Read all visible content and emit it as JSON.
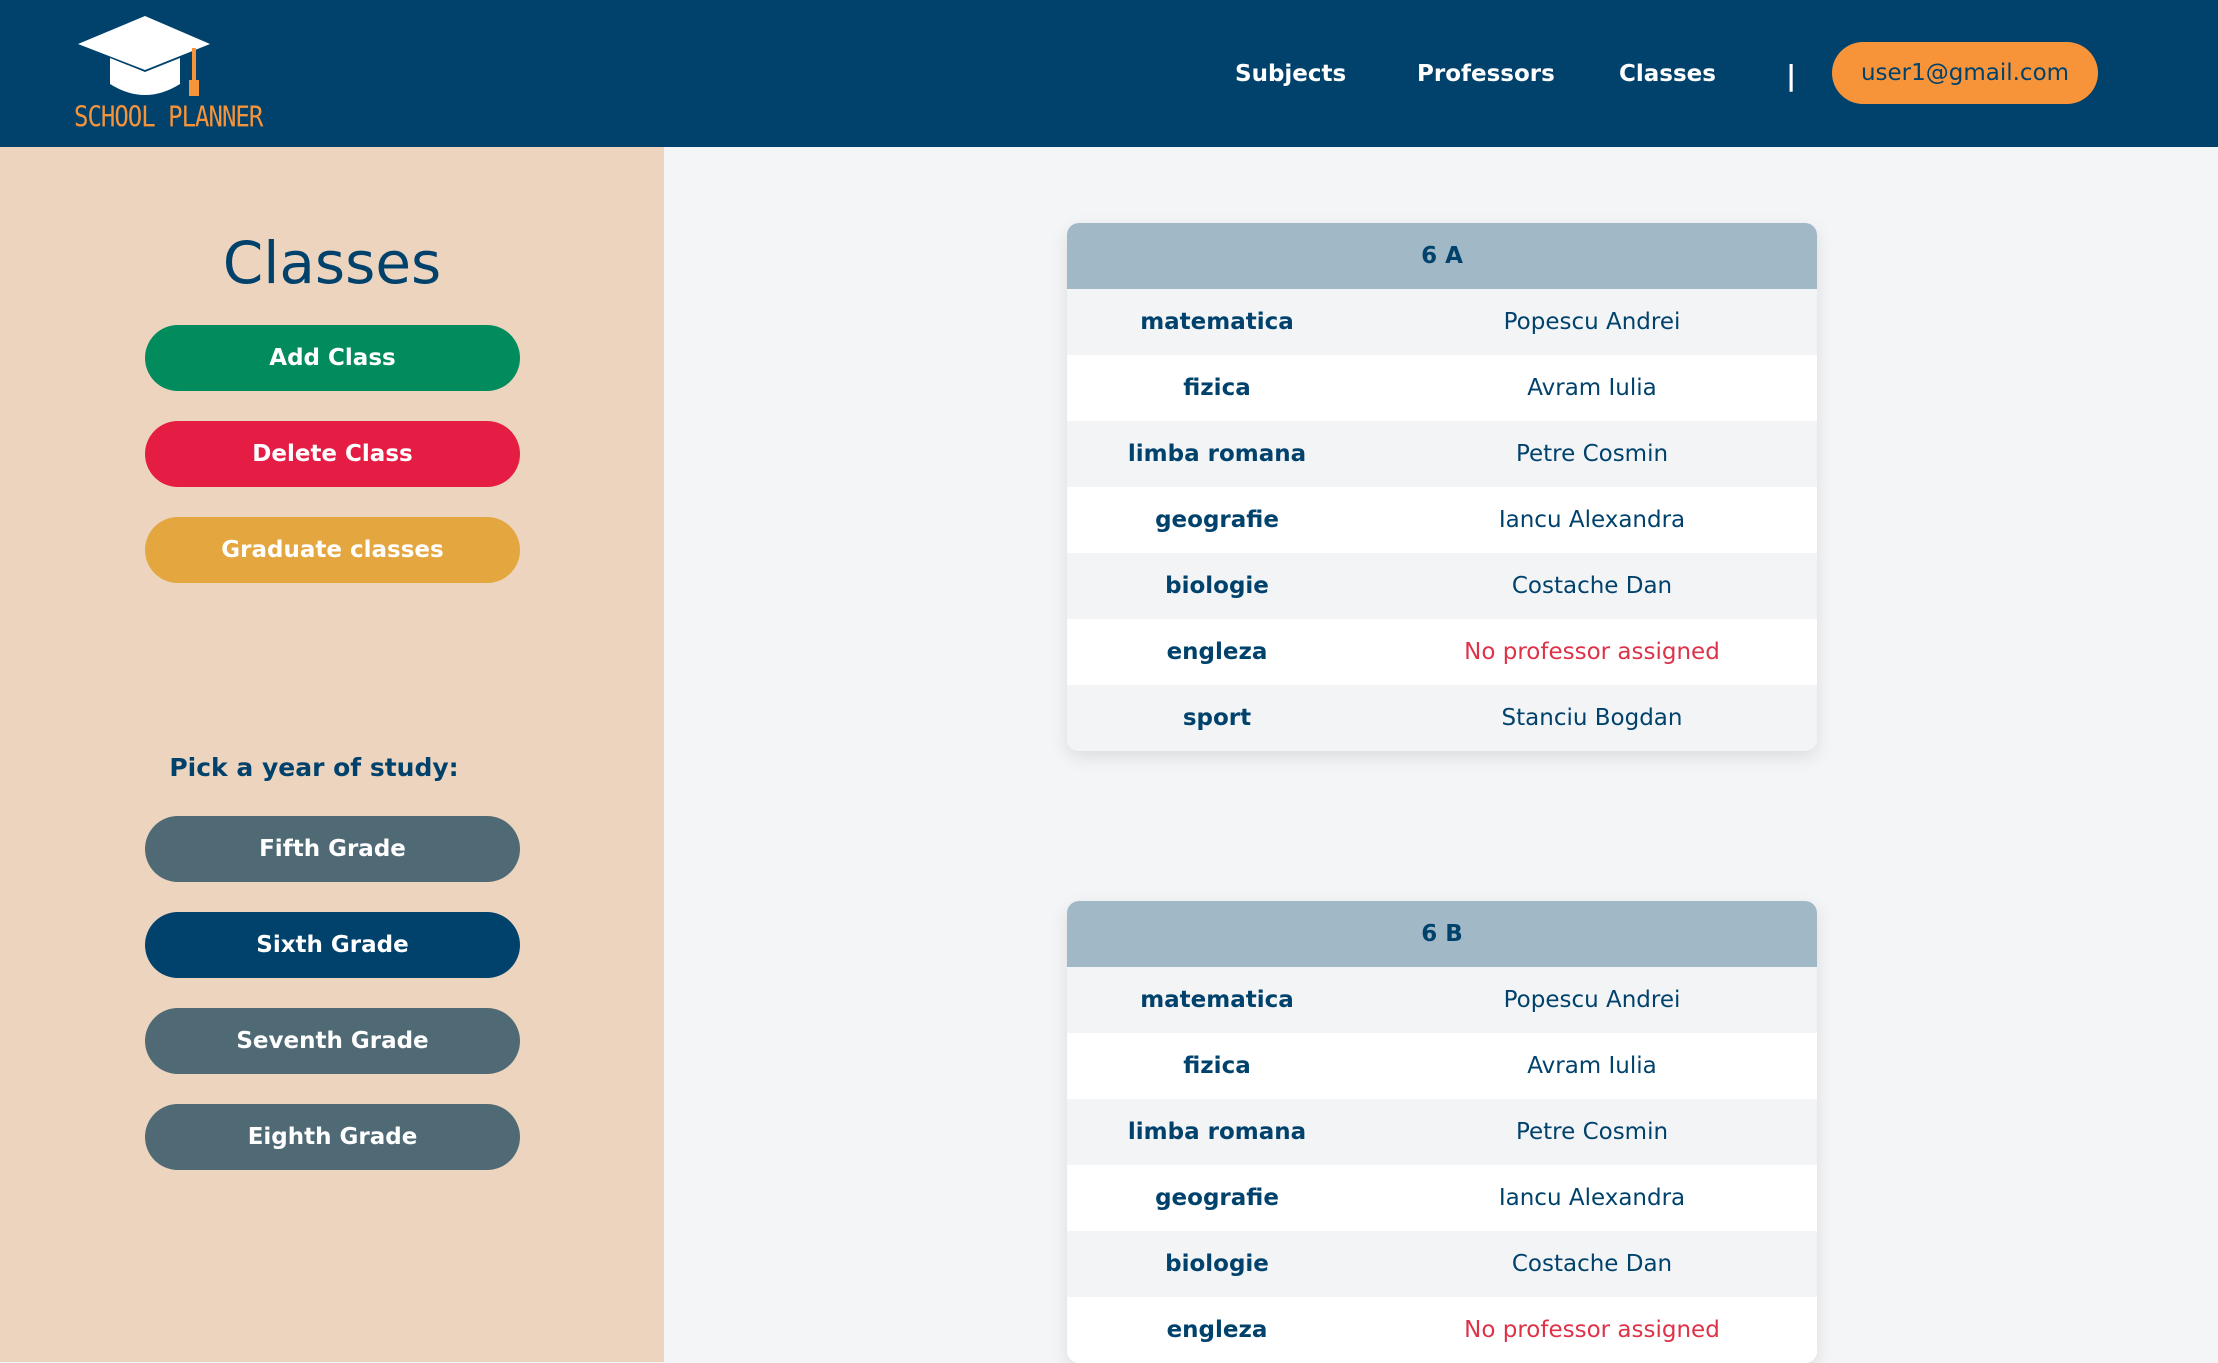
{
  "header": {
    "logo_text": "SCHOOL PLANNER",
    "nav": [
      "Subjects",
      "Professors",
      "Classes"
    ],
    "separator": "|",
    "user_email": "user1@gmail.com"
  },
  "sidebar": {
    "title": "Classes",
    "actions": [
      {
        "label": "Add Class",
        "color": "#028b5c"
      },
      {
        "label": "Delete Class",
        "color": "#e51d44"
      },
      {
        "label": "Graduate classes",
        "color": "#e4a63e"
      }
    ],
    "pick_label": "Pick a year of study:",
    "grades": [
      {
        "label": "Fifth Grade",
        "selected": false
      },
      {
        "label": "Sixth Grade",
        "selected": true
      },
      {
        "label": "Seventh Grade",
        "selected": false
      },
      {
        "label": "Eighth Grade",
        "selected": false
      }
    ]
  },
  "colors": {
    "brand": "#01426c",
    "accent": "#f7943a",
    "grade_default": "#4f6a75",
    "grade_selected": "#01426c",
    "no_professor": "#de3249"
  },
  "classes": [
    {
      "name": "6 A",
      "rows": [
        {
          "subject": "matematica",
          "professor": "Popescu Andrei"
        },
        {
          "subject": "fizica",
          "professor": "Avram Iulia"
        },
        {
          "subject": "limba romana",
          "professor": "Petre Cosmin"
        },
        {
          "subject": "geografie",
          "professor": "Iancu Alexandra"
        },
        {
          "subject": "biologie",
          "professor": "Costache Dan"
        },
        {
          "subject": "engleza",
          "professor": "No professor assigned",
          "unassigned": true
        },
        {
          "subject": "sport",
          "professor": "Stanciu Bogdan"
        }
      ]
    },
    {
      "name": "6 B",
      "rows": [
        {
          "subject": "matematica",
          "professor": "Popescu Andrei"
        },
        {
          "subject": "fizica",
          "professor": "Avram Iulia"
        },
        {
          "subject": "limba romana",
          "professor": "Petre Cosmin"
        },
        {
          "subject": "geografie",
          "professor": "Iancu Alexandra"
        },
        {
          "subject": "biologie",
          "professor": "Costache Dan"
        },
        {
          "subject": "engleza",
          "professor": "No professor assigned",
          "unassigned": true
        }
      ]
    }
  ]
}
